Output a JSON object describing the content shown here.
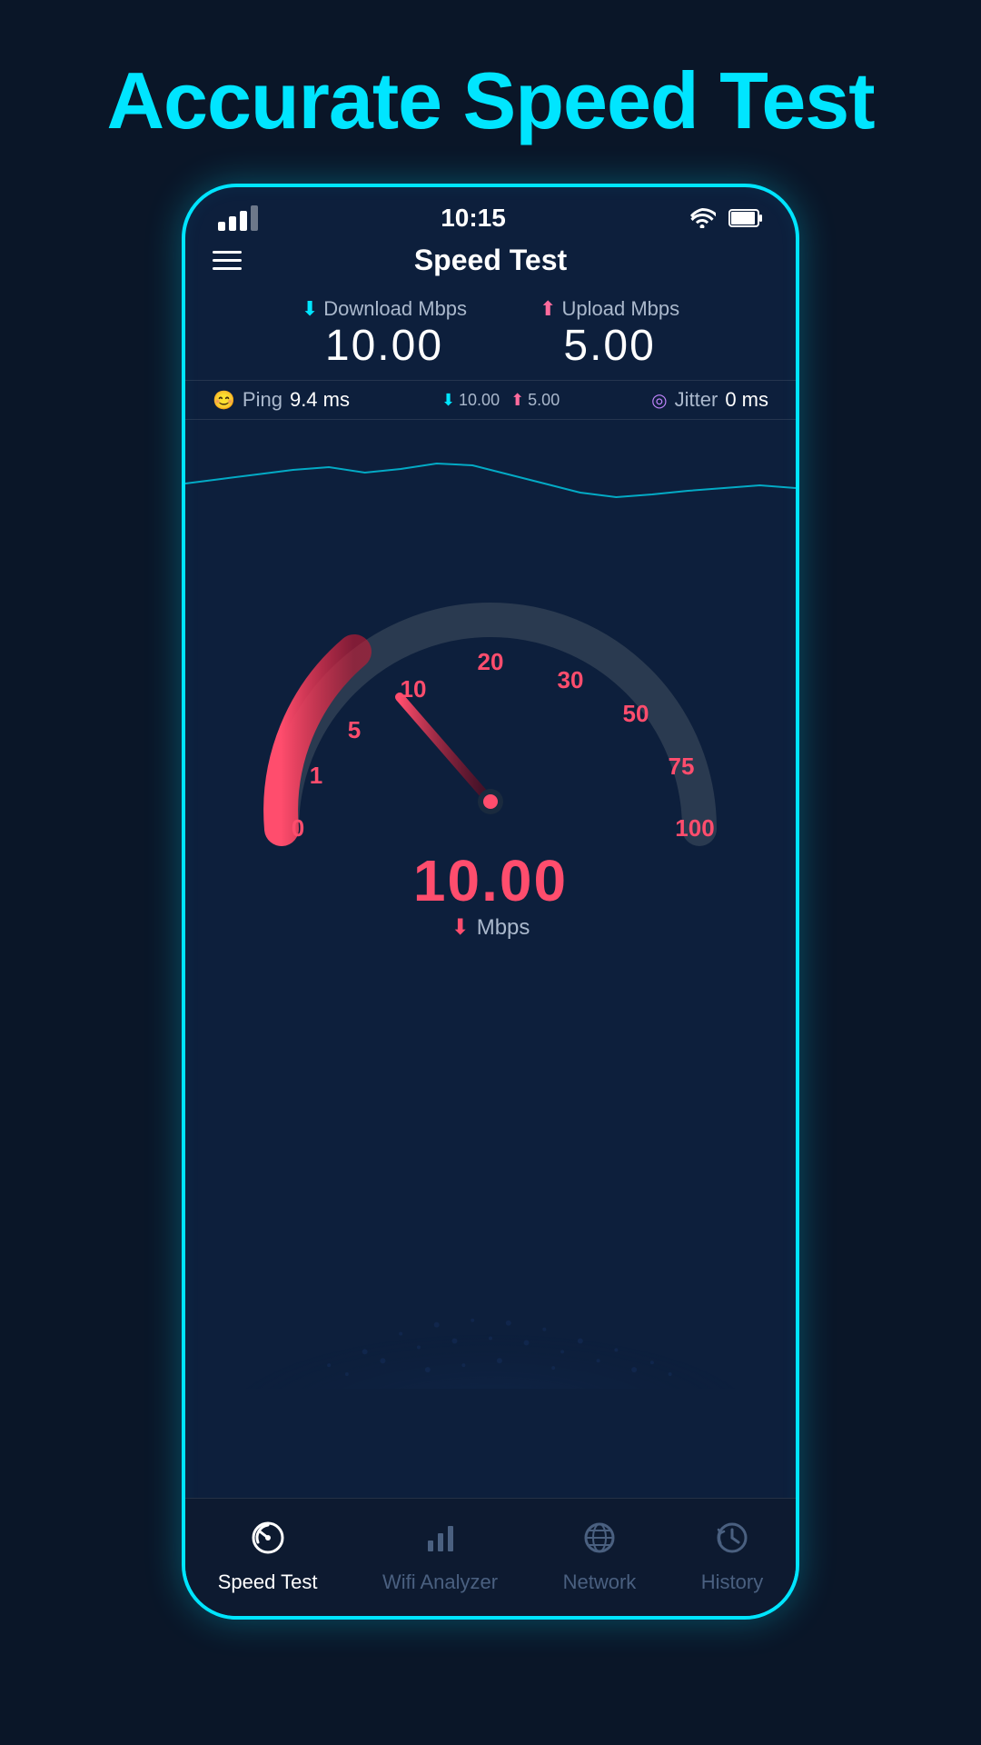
{
  "page": {
    "title": "Accurate Speed Test"
  },
  "status_bar": {
    "time": "10:15"
  },
  "header": {
    "title": "Speed Test"
  },
  "download": {
    "label": "Download Mbps",
    "value": "10.00"
  },
  "upload": {
    "label": "Upload Mbps",
    "value": "5.00"
  },
  "ping": {
    "label": "Ping",
    "value": "9.4 ms"
  },
  "jitter": {
    "label": "Jitter",
    "value": "0 ms"
  },
  "speed_pills": {
    "download": "10.00",
    "upload": "5.00"
  },
  "speedometer": {
    "value": "10.00",
    "unit": "Mbps",
    "ticks": [
      "0",
      "1",
      "5",
      "10",
      "20",
      "30",
      "50",
      "75",
      "100"
    ]
  },
  "nav": {
    "items": [
      {
        "id": "speed-test",
        "label": "Speed Test",
        "active": true
      },
      {
        "id": "wifi-analyzer",
        "label": "Wifi Analyzer",
        "active": false
      },
      {
        "id": "network",
        "label": "Network",
        "active": false
      },
      {
        "id": "history",
        "label": "History",
        "active": false
      }
    ]
  }
}
